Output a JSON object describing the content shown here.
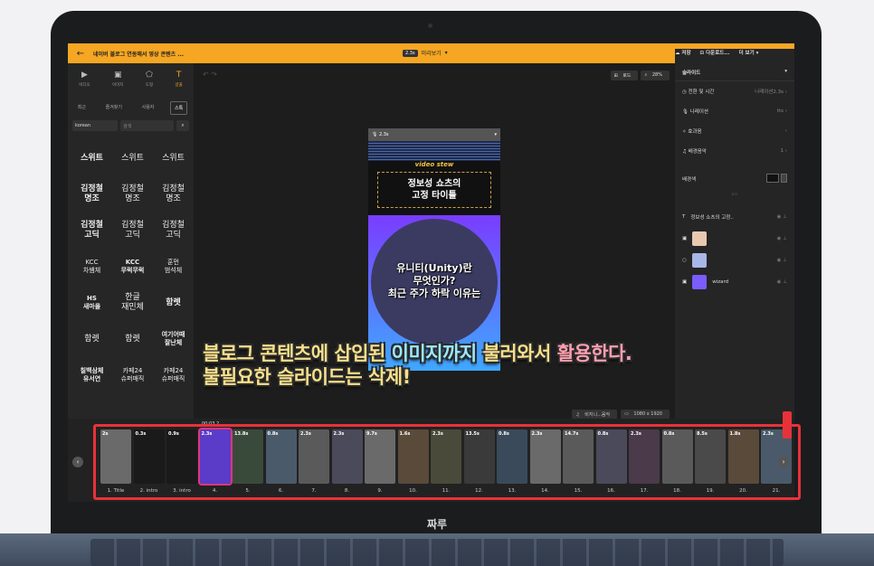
{
  "topbar": {
    "title": "네이버 블로그 연동해서 영상 콘텐츠 ...",
    "duration": "2.3s",
    "preview_label": "미리보기",
    "save_label": "저장",
    "download_label": "다운로드...",
    "more_label": "더 보기"
  },
  "left_tabs": [
    {
      "label": "비디오",
      "icon": "video-icon"
    },
    {
      "label": "이미지",
      "icon": "image-icon"
    },
    {
      "label": "도형",
      "icon": "shape-icon"
    },
    {
      "label": "글꼴",
      "icon": "text-icon"
    }
  ],
  "sub_tabs": [
    "최근",
    "즐겨찾기",
    "사용자",
    "스톡"
  ],
  "search": {
    "language": "korean",
    "placeholder": "검색"
  },
  "fonts": [
    {
      "text": "스위트",
      "style": "b"
    },
    {
      "text": "스위트",
      "style": ""
    },
    {
      "text": "스위트",
      "style": ""
    },
    {
      "text": "김정철\n명조",
      "style": "b"
    },
    {
      "text": "김정철\n명조",
      "style": ""
    },
    {
      "text": "김정철\n명조",
      "style": ""
    },
    {
      "text": "김정철\n고딕",
      "style": "b"
    },
    {
      "text": "김정철\n고딕",
      "style": ""
    },
    {
      "text": "김정철\n고딕",
      "style": ""
    },
    {
      "text": "KCC\n차쌤체",
      "style": "s"
    },
    {
      "text": "KCC\n무럭무럭",
      "style": "b s"
    },
    {
      "text": "훈먼\n범석체",
      "style": "s"
    },
    {
      "text": "HS\n새마을",
      "style": "b s"
    },
    {
      "text": "한글\n재민체",
      "style": ""
    },
    {
      "text": "함렛",
      "style": "b"
    },
    {
      "text": "함렛",
      "style": ""
    },
    {
      "text": "함렛",
      "style": ""
    },
    {
      "text": "여기어때\n잘난체",
      "style": "b s"
    },
    {
      "text": "칠백삼체\n유서연",
      "style": "b s"
    },
    {
      "text": "카페24\n슈퍼매직",
      "style": "s"
    },
    {
      "text": "카페24\n슈퍼매직",
      "style": "s"
    }
  ],
  "canvas": {
    "fit_label": "로드",
    "zoom": "28%",
    "frame_duration": "2.3s",
    "brand_text": "video stew",
    "title_line1": "정보성 쇼츠의",
    "title_line2": "고정 타이틀",
    "video_line1": "유니티(Unity)란",
    "video_line2": "무엇인가?",
    "video_line3": "최근 주가 하락 이유는",
    "music_label": "비지니...음악",
    "resolution": "1080 x 1920"
  },
  "right_panel": {
    "header": "슬라이드",
    "rows": [
      {
        "label": "전환 및 시간",
        "value": "나레이션2.3s"
      },
      {
        "label": "나레이션",
        "value": "tts"
      },
      {
        "label": "효과음",
        "value": ""
      },
      {
        "label": "배경음악",
        "value": "1"
      }
    ],
    "bg_label": "배경색",
    "layer_sep": "요소",
    "layers": [
      {
        "label": "정보성 쇼츠의 고정..",
        "thumb_color": "#00000000"
      },
      {
        "label": "",
        "thumb_color": "#e8c9b0"
      },
      {
        "label": "",
        "thumb_color": "#a9b6e8"
      },
      {
        "label": "wizard",
        "thumb_color": "#7a5cff"
      }
    ]
  },
  "timeline": {
    "playhead_time": "00:03.2",
    "clips": [
      {
        "duration": "2s",
        "label": "1. Title",
        "color": "#6a6a6a"
      },
      {
        "duration": "0.3s",
        "label": "2. intro",
        "color": "#1a1a1a"
      },
      {
        "duration": "0.9s",
        "label": "3. intro",
        "color": "#1a1a1a"
      },
      {
        "duration": "2.3s",
        "label": "4.",
        "color": "#5a3cc8"
      },
      {
        "duration": "13.8s",
        "label": "5.",
        "color": "#3a4a3a"
      },
      {
        "duration": "0.8s",
        "label": "6.",
        "color": "#4a5a6a"
      },
      {
        "duration": "2.3s",
        "label": "7.",
        "color": "#5a5a5a"
      },
      {
        "duration": "2.3s",
        "label": "8.",
        "color": "#4a4a5a"
      },
      {
        "duration": "9.7s",
        "label": "9.",
        "color": "#6a6a6a"
      },
      {
        "duration": "1.6s",
        "label": "10.",
        "color": "#5a4a3a"
      },
      {
        "duration": "2.3s",
        "label": "11.",
        "color": "#4a4a3a"
      },
      {
        "duration": "13.5s",
        "label": "12.",
        "color": "#3a3a3a"
      },
      {
        "duration": "0.8s",
        "label": "13.",
        "color": "#3a4a5a"
      },
      {
        "duration": "2.3s",
        "label": "14.",
        "color": "#6a6a6a"
      },
      {
        "duration": "14.7s",
        "label": "15.",
        "color": "#5a5a5a"
      },
      {
        "duration": "0.8s",
        "label": "16.",
        "color": "#4a4a5a"
      },
      {
        "duration": "2.3s",
        "label": "17.",
        "color": "#4a3a4a"
      },
      {
        "duration": "0.8s",
        "label": "18.",
        "color": "#5a5a5a"
      },
      {
        "duration": "8.5s",
        "label": "19.",
        "color": "#4a4a4a"
      },
      {
        "duration": "1.8s",
        "label": "20.",
        "color": "#5a4a3a"
      },
      {
        "duration": "2.3s",
        "label": "21.",
        "color": "#4a5a6a"
      }
    ]
  },
  "caption": {
    "line1_a": "블로그 콘텐츠에 삽입된 ",
    "line1_b": "이미지까지 ",
    "line1_c": "불러와서 ",
    "line1_d": "활용한다.",
    "line2": "불필요한 슬라이드는 삭제!"
  },
  "brand": "짜루"
}
